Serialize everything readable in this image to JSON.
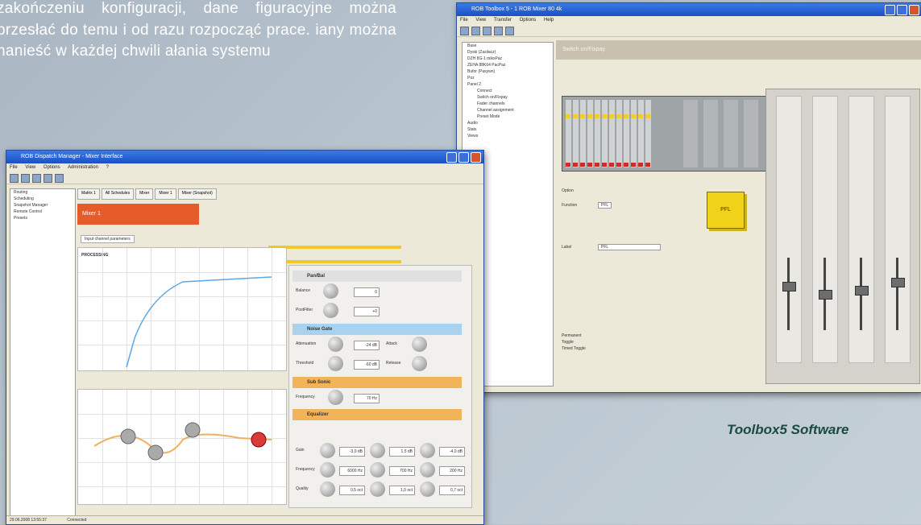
{
  "paragraph": "zakończeniu konfiguracji, dane figuracyjne można przesłać do temu i od razu rozpocząć prace. iany można nanieść w każdej chwili ałania systemu",
  "caption": "Toolbox5 Software",
  "colors": {
    "background": "#b8c4ce",
    "caption": "#1b4a3e",
    "orange": "#e65b2a",
    "yellow": "#f0d21a"
  },
  "right_window": {
    "title": "ROB Toolbox 5 - 1 ROB Mixer 80 4k",
    "menu": [
      "File",
      "View",
      "Transfer",
      "Options",
      "Help"
    ],
    "tree": [
      "Base",
      "Dyski (Zasilacz)",
      "DZH 8G-1 miksPaz",
      "ZEHA 88K64 PacPaz",
      "Bufor (Pasywn)",
      "Poz",
      "Panel 2",
      "Connect",
      "Switch on/Fixpay",
      "Fader channels",
      "Channel assignment",
      "Preset Mode",
      "Audio",
      "Stats",
      "Views"
    ],
    "section_label": "Option",
    "pfl_label": "PFL",
    "field_function_label": "Function",
    "field_function_value": "PFL",
    "field_label_label": "Label",
    "field_label_value": "PFL",
    "radio_options": [
      "Permanent",
      "Toggle",
      "Timed Toggle"
    ],
    "status": "Switch on/Fixpay"
  },
  "left_window": {
    "title": "ROB Dispatch Manager - Mixer Interface",
    "menu": [
      "File",
      "View",
      "Options",
      "Administration",
      "?"
    ],
    "tree": [
      "Routing",
      "Scheduling",
      "Snapshot Manager",
      "Remote Control",
      "Presets"
    ],
    "tabs": [
      "Matrix 1",
      "All Schedules",
      "Mixer",
      "Mixer 1",
      "Mixer (Snapshot)"
    ],
    "banner": "Mixer 1",
    "subtab": "Input channel parameters",
    "graph_label": "PROCESSING",
    "section_pan": "Pan/Bal",
    "section_gate": "Noise Gate",
    "section_sub": "Sub Sonic",
    "section_eq": "Equalizer",
    "balance_label": "Balance",
    "balance_value": "0",
    "pre_label": "PostFilter",
    "pre_value": "+0",
    "attenuation_label": "Attenuation",
    "attenuation_value": "-24 dB",
    "attack_label": "Attack",
    "threshold_label": "Threshold",
    "threshold_value": "-60 dB",
    "release_label": "Release",
    "frequency_label": "Frequency",
    "frequency_value": "70 Hz",
    "gain_label": "Gain",
    "gain_values": [
      "-3,0 dB",
      "1,5 dB",
      "-4,0 dB"
    ],
    "eq_freq_label": "Frequency",
    "eq_freq_values": [
      "6000 Hz",
      "700 Hz",
      "200 Hz"
    ],
    "quality_label": "Quality",
    "quality_values": [
      "0,5 oct",
      "1,0 oct",
      "0,7 oct"
    ],
    "status": "29.06.2008 13:55:37",
    "status2": "Connected"
  }
}
